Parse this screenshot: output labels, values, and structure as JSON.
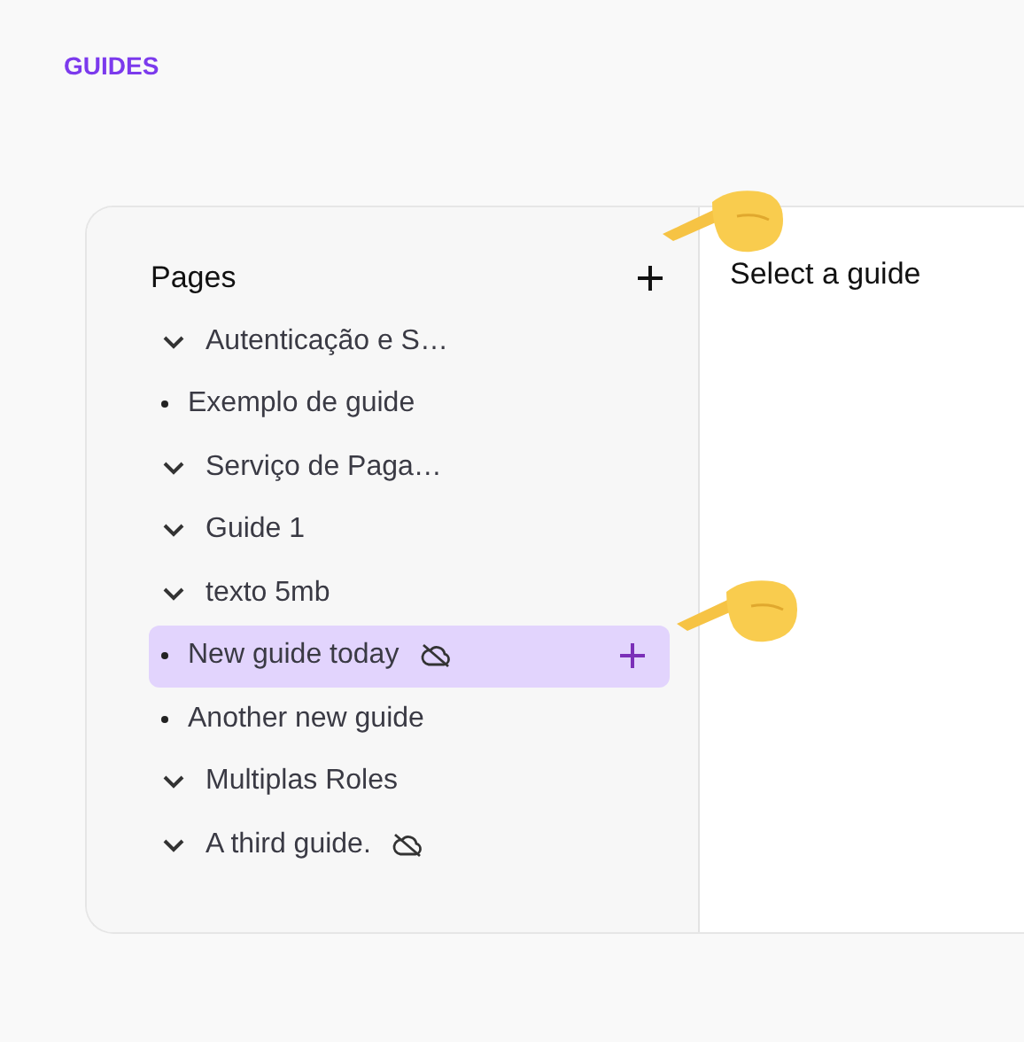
{
  "header": {
    "title": "GUIDES"
  },
  "sidebar": {
    "title": "Pages",
    "items": [
      {
        "kind": "folder",
        "label": "Autenticação e S…",
        "selected": false,
        "cloud_off": false
      },
      {
        "kind": "page",
        "label": "Exemplo de guide",
        "selected": false,
        "cloud_off": false
      },
      {
        "kind": "folder",
        "label": "Serviço de Paga…",
        "selected": false,
        "cloud_off": false
      },
      {
        "kind": "folder",
        "label": "Guide 1",
        "selected": false,
        "cloud_off": false
      },
      {
        "kind": "folder",
        "label": "texto 5mb",
        "selected": false,
        "cloud_off": false
      },
      {
        "kind": "page",
        "label": "New guide today",
        "selected": true,
        "cloud_off": true
      },
      {
        "kind": "page",
        "label": "Another new guide",
        "selected": false,
        "cloud_off": false
      },
      {
        "kind": "folder",
        "label": "Multiplas Roles",
        "selected": false,
        "cloud_off": false
      },
      {
        "kind": "folder",
        "label": "A third guide.",
        "selected": false,
        "cloud_off": true
      }
    ]
  },
  "main": {
    "title": "Select a guide"
  }
}
